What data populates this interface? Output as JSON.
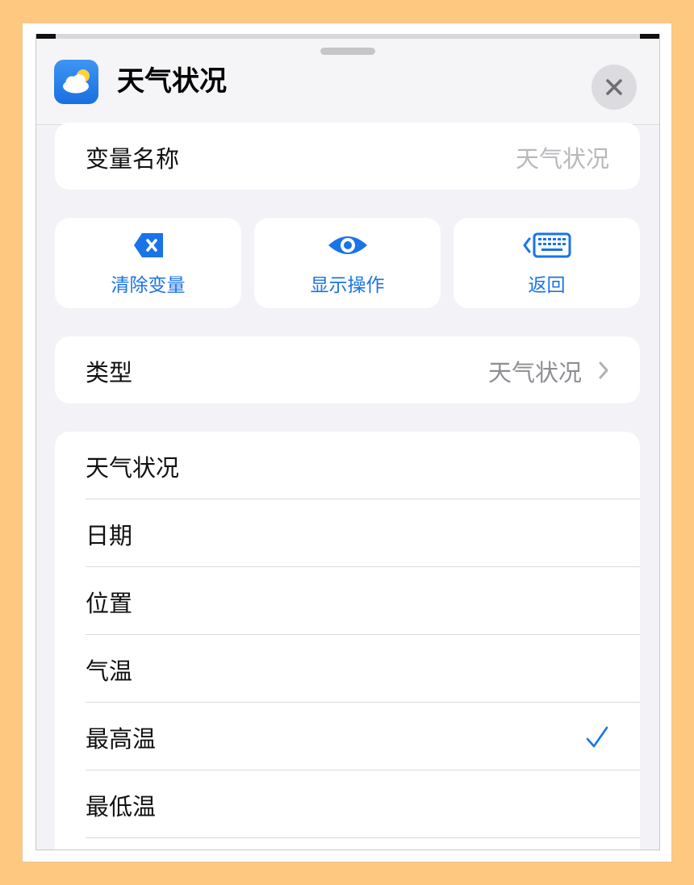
{
  "header": {
    "title": "天气状况",
    "app_icon": "weather-app-icon",
    "close_icon": "close-icon"
  },
  "variable_name": {
    "label": "变量名称",
    "value": "天气状况"
  },
  "actions": [
    {
      "label": "清除变量",
      "icon": "clear-variable-icon"
    },
    {
      "label": "显示操作",
      "icon": "eye-icon"
    },
    {
      "label": "返回",
      "icon": "keyboard-back-icon"
    }
  ],
  "type_row": {
    "label": "类型",
    "value": "天气状况"
  },
  "list": {
    "items": [
      {
        "label": "天气状况",
        "checked": false
      },
      {
        "label": "日期",
        "checked": false
      },
      {
        "label": "位置",
        "checked": false
      },
      {
        "label": "气温",
        "checked": false
      },
      {
        "label": "最高温",
        "checked": true
      },
      {
        "label": "最低温",
        "checked": false
      }
    ]
  },
  "colors": {
    "accent": "#1a73e8",
    "background": "#f2f2f7",
    "page_border": "#ffc880"
  }
}
